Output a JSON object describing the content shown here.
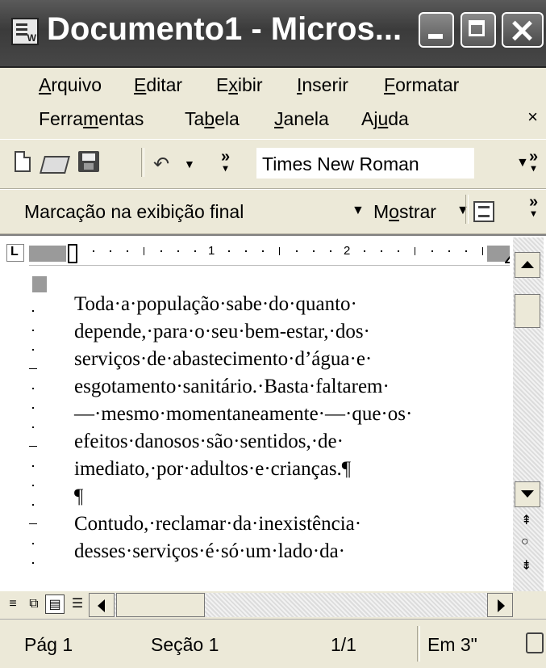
{
  "window": {
    "title": "Documento1 - Micros..."
  },
  "menu": {
    "row1": [
      {
        "pre": "",
        "u": "A",
        "post": "rquivo"
      },
      {
        "pre": "",
        "u": "E",
        "post": "ditar"
      },
      {
        "pre": "E",
        "u": "x",
        "post": "ibir"
      },
      {
        "pre": "",
        "u": "I",
        "post": "nserir"
      },
      {
        "pre": "",
        "u": "F",
        "post": "ormatar"
      }
    ],
    "row2": [
      {
        "pre": "Ferra",
        "u": "m",
        "post": "entas"
      },
      {
        "pre": "Ta",
        "u": "b",
        "post": "ela"
      },
      {
        "pre": "",
        "u": "J",
        "post": "anela"
      },
      {
        "pre": "Aj",
        "u": "u",
        "post": "da"
      }
    ],
    "close_glyph": "×"
  },
  "toolbar": {
    "font_name": "Times New Roman",
    "markup_mode": "Marcação na exibição final",
    "show_label": "Mostrar",
    "show_label_underline": "o"
  },
  "ruler": {
    "numbers": [
      "1",
      "2"
    ]
  },
  "document": {
    "lines": [
      "Toda·a·população·sabe·do·quanto·",
      "depende,·para·o·seu·bem-estar,·dos·",
      "serviços·de·abastecimento·d’água·e·",
      "esgotamento·sanitário.·Basta·faltarem·",
      "—·mesmo·momentaneamente·—·que·os·",
      "efeitos·danosos·são·sentidos,·de·",
      "imediato,·por·adultos·e·crianças.¶",
      "¶",
      "Contudo,·reclamar·da·inexistência·",
      "desses·serviços·é·só·um·lado·da·"
    ]
  },
  "status": {
    "page": "Pág 1",
    "section": "Seção 1",
    "pages": "1/1",
    "position": "Em 3\""
  },
  "icons": {
    "new": "new-document-icon",
    "open": "open-folder-icon",
    "save": "save-disk-icon",
    "undo": "undo-icon",
    "accept": "accept-change-icon"
  }
}
